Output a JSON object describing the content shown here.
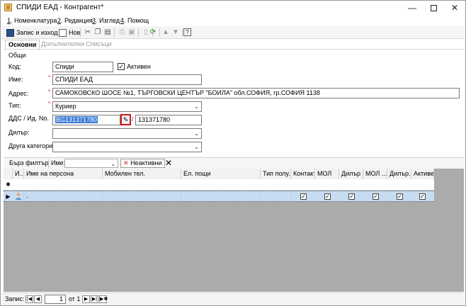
{
  "window": {
    "title": "СПИДИ ЕАД - Контрагент*",
    "controls": {
      "minimize": "—",
      "maximize": "",
      "close": "✕"
    }
  },
  "menu": [
    {
      "key": "1",
      "label": ". Номенклатура"
    },
    {
      "key": "2",
      "label": ". Редакция"
    },
    {
      "key": "3",
      "label": ". Изглед"
    },
    {
      "key": "4",
      "label": ". Помощ"
    }
  ],
  "toolbar": {
    "save_exit": "Запис и изход",
    "new": "Нов"
  },
  "tabs": [
    "Основни",
    "Допълнителни",
    "Списъци"
  ],
  "group": "Общи",
  "form": {
    "code_label": "Код:",
    "code_value": "Спиди",
    "active_label": "Активен",
    "active_checked": "✓",
    "name_label": "Име:",
    "name_value": "СПИДИ ЕАД",
    "address_label": "Адрес:",
    "address_value": "САМОКОВСКО ШОСЕ  №1,  ТЪРГОВСКИ ЦЕНТЪР \"БОИЛА\" обл.СОФИЯ, гр.СОФИЯ 1138",
    "type_label": "Тип:",
    "type_value": "Куриер",
    "vat_label": "ДДС / Ид. No.",
    "vat_value": "BG131371780",
    "id_value": "131371780",
    "dealer_label": "Дилър:",
    "dealer_value": "",
    "other_category_label": "Друга категория",
    "other_category_value": "",
    "required_mark": "*"
  },
  "grid_toolbar": {
    "quick_filter": "Бърз филтър",
    "name_label": "Име:",
    "inactive_label": "Неактивни"
  },
  "grid": {
    "columns": [
      "И...",
      "Име на персона",
      "Мобилен тел.",
      "Ел. пощи",
      "Тип полу...",
      "Контакт",
      "МОЛ",
      "Дилър",
      "МОЛ ...",
      "Дилър...",
      "Активен"
    ],
    "new_row_marker": "✱",
    "row": {
      "indicator": "▶",
      "name": ".",
      "checks": [
        "✓",
        "✓",
        "✓",
        "✓",
        "✓",
        "✓"
      ]
    }
  },
  "statusbar": {
    "record_label": "Запис:",
    "current": "1",
    "of_label": "от 1"
  }
}
